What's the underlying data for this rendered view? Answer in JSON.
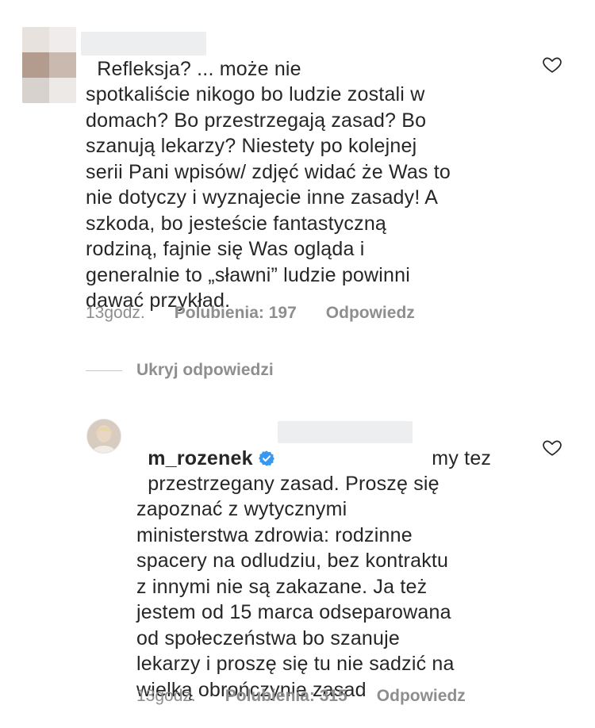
{
  "comment1": {
    "text": "Refleksja? ... może nie\nspotkaliście nikogo bo ludzie zostali w\ndomach? Bo przestrzegają zasad? Bo\nszanują lekarzy? Niestety po kolejnej\nserii Pani wpisów/ zdjęć widać że Was to\nnie dotyczy i wyznajecie inne zasady! A\nszkoda, bo jesteście fantastyczną\nrodziną, fajnie się Was ogląda i\ngeneralnie to „sławni” ludzie powinni\ndawać przykład.",
    "time": "13godz.",
    "likes": "Polubienia: 197",
    "reply": "Odpowiedz",
    "heart_icon": "heart-outline-icon"
  },
  "hide_replies": {
    "label": "Ukryj odpowiedzi"
  },
  "comment2": {
    "username": "m_rozenek",
    "verified_icon": "verified-badge-icon",
    "text_first": "my tez",
    "text": "przestrzegany zasad. Proszę się\nzapoznać z wytycznymi\nministerstwa zdrowia: rodzinne\nspacery na odludziu, bez kontraktu\nz innymi nie są zakazane. Ja też\njestem od 15 marca odseparowana\nod społeczeństwa bo szanuje\nlekarzy i proszę się tu nie sadzić na\nwielką obrończynie zasad",
    "time": "13godz.",
    "likes": "Polubienia: 315",
    "reply": "Odpowiedz",
    "heart_icon": "heart-outline-icon"
  },
  "colors": {
    "text": "#262626",
    "secondary": "#8e8e8e",
    "verified": "#3897f0"
  }
}
